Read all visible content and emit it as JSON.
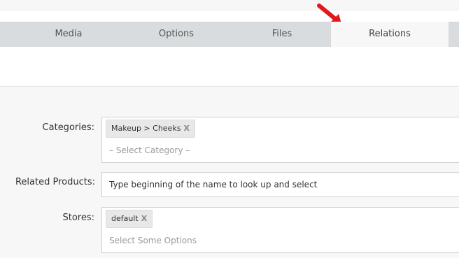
{
  "tabs": [
    {
      "label": "Media",
      "active": false
    },
    {
      "label": "Options",
      "active": false
    },
    {
      "label": "Files",
      "active": false
    },
    {
      "label": "Relations",
      "active": true
    }
  ],
  "form": {
    "categories": {
      "label": "Categories:",
      "selected": [
        {
          "text": "Makeup > Cheeks",
          "remove": "X"
        }
      ],
      "placeholder": "– Select Category –"
    },
    "related_products": {
      "label": "Related Products:",
      "hint": "Type beginning of the name to look up and select"
    },
    "stores": {
      "label": "Stores:",
      "selected": [
        {
          "text": "default",
          "remove": "X"
        }
      ],
      "placeholder": "Select Some Options"
    }
  },
  "colors": {
    "tabbar": "#d9dcde",
    "active_tab": "#f7f7f7",
    "arrow": "#e0191b"
  }
}
